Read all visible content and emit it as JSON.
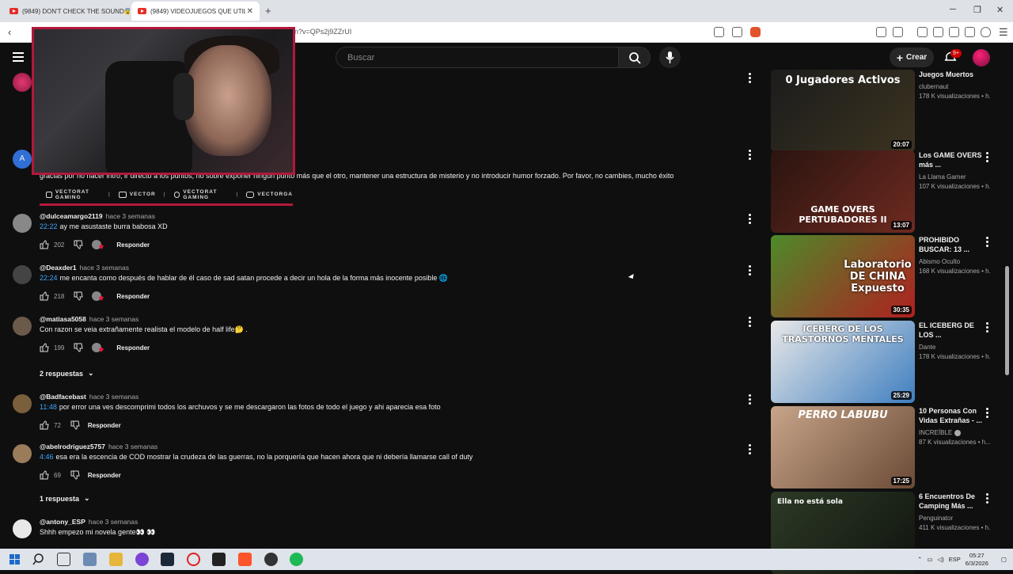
{
  "browser": {
    "tabs": [
      {
        "title": "(9849) DON'T CHECK THE SOUND😨"
      },
      {
        "title": "(9849) VIDEOJUEGOS QUE UTILI"
      }
    ],
    "url": "n?v=QPs2j9ZZrUI"
  },
  "header": {
    "search_placeholder": "Buscar",
    "create_label": "Crear",
    "notif_badge": "9+"
  },
  "top_comment_partial": "gracias por no hacer intro, ir directo a los puntos, no sobre exponer ningún punto más que el otro, mantener una estructura de misterio y no introducir humor forzado. Por favor, no cambies, mucho éxito",
  "overlay": {
    "social": [
      "VECTORAT GAMING",
      "VECTOR",
      "VECTORAT GAMING",
      "VECTORGA"
    ]
  },
  "comments": [
    {
      "author": "@dulceamargo2119",
      "time": "hace 3 semanas",
      "ts": "22:22",
      "text": "ay me asustaste burra babosa XD",
      "likes": "202",
      "reply": "Responder"
    },
    {
      "author": "@Deaxder1",
      "time": "hace 3 semanas",
      "ts": "22:24",
      "text": "me encanta como después de hablar de él caso de sad satan procede a decir un hola de la forma más inocente posible 🌐",
      "likes": "218",
      "reply": "Responder"
    },
    {
      "author": "@matiasa5058",
      "time": "hace 3 semanas",
      "ts": "",
      "text": "Con razon se veia extrañamente realista el modelo de half life🤔 .",
      "likes": "199",
      "reply": "Responder",
      "replies": "2 respuestas"
    },
    {
      "author": "@Badfacebast",
      "time": "hace 3 semanas",
      "ts": "11:48",
      "text": "por error una ves descomprimi todos los archuvos y se me descargaron las fotos de todo el juego y ahi aparecia esa foto",
      "likes": "72",
      "reply": "Responder"
    },
    {
      "author": "@abelrodriguez5757",
      "time": "hace 3 semanas",
      "ts": "4:46",
      "text": "esa era la escencia de COD mostrar la crudeza de las guerras, no la porquería que hacen ahora que ni debería llamarse call of duty",
      "likes": "69",
      "reply": "Responder",
      "replies": "1 respuesta"
    },
    {
      "author": "@antony_ESP",
      "time": "hace 3 semanas",
      "ts": "",
      "text": "Shhh empezo mi novela gente👀 👀",
      "likes": "",
      "reply": "Responder"
    }
  ],
  "sidebar": [
    {
      "title": "Juegos Muertos",
      "channel": "clubernaut",
      "views": "178 K visualizaciones • h...",
      "duration": "20:07",
      "thumb_text": "0 Jugadores Activos",
      "colors": [
        "#1c1c1c",
        "#3b3320"
      ]
    },
    {
      "title": "Los GAME OVERS más ...",
      "channel": "La Llama Gamer",
      "views": "107 K visualizaciones • h...",
      "duration": "13:07",
      "thumb_text": "GAME OVERS PERTUBADORES II",
      "colors": [
        "#2a1410",
        "#6e2a20"
      ]
    },
    {
      "title": "PROHIBIDO BUSCAR: 13 ...",
      "channel": "Abismo Oculto",
      "views": "168 K visualizaciones • h...",
      "duration": "30:35",
      "thumb_text": "Laboratorio DE CHINA Expuesto",
      "colors": [
        "#4d8a2a",
        "#b02020"
      ]
    },
    {
      "title": "EL ICEBERG DE LOS ...",
      "channel": "Dante",
      "views": "178 K visualizaciones • h...",
      "duration": "25:29",
      "thumb_text": "ICEBERG DE LOS TRASTORNOS MENTALES",
      "colors": [
        "#e8e8e8",
        "#3f7fc0"
      ]
    },
    {
      "title": "10 Personas Con Vidas Extrañas - ...",
      "channel": "INCREÍBLE",
      "views": "87 K visualizaciones • h...",
      "duration": "17:25",
      "thumb_text": "PERRO   LABUBU",
      "colors": [
        "#c7a58a",
        "#6b4a36"
      ],
      "verified": true
    },
    {
      "title": "6 Encuentros De Camping Más ...",
      "channel": "Penguinator",
      "views": "411 K visualizaciones • h...",
      "duration": "",
      "thumb_text": "Ella no está sola",
      "colors": [
        "#2d3a26",
        "#10140e"
      ]
    }
  ],
  "taskbar": {
    "time": "05:27",
    "date": "6/3/2026",
    "lang": "ESP"
  }
}
